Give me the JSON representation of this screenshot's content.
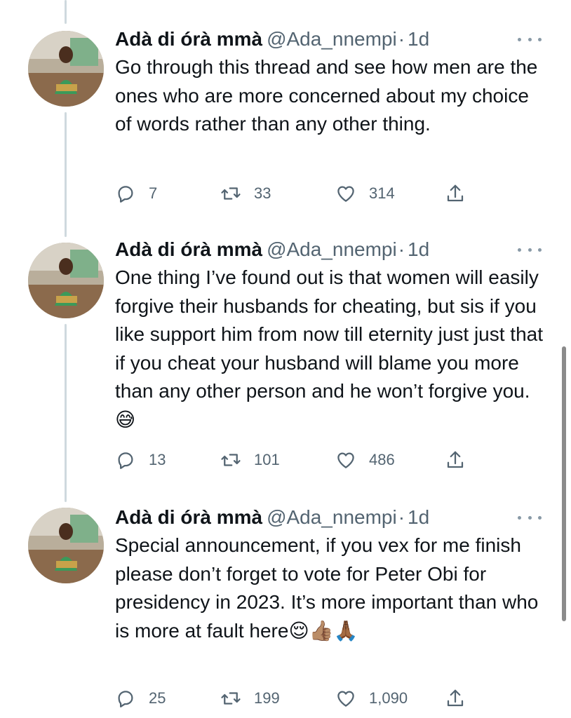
{
  "tweets": [
    {
      "name": "Adà di órà mmà",
      "handle": "@Ada_nnempi",
      "separator": "·",
      "time": "1d",
      "text": "Go through this thread and see how men are the ones who are more concerned about my choice of words rather than any other thing.",
      "emoji": "",
      "replies": "7",
      "retweets": "33",
      "likes": "314"
    },
    {
      "name": "Adà di órà mmà",
      "handle": "@Ada_nnempi",
      "separator": "·",
      "time": "1d",
      "text": "One thing I’ve found out is that women will easily forgive their husbands for cheating, but sis if you like support him from now till eternity just just that if you cheat your husband will blame you more than any other person and he won’t forgive you.",
      "emoji": "😅",
      "replies": "13",
      "retweets": "101",
      "likes": "486"
    },
    {
      "name": "Adà di órà mmà",
      "handle": "@Ada_nnempi",
      "separator": "·",
      "time": "1d",
      "text": "Special announcement, if you vex for me finish please don’t forget to vote for Peter Obi for presidency in 2023. It’s more important than who is more at fault here",
      "emoji": "😌👍🏽🙏🏾",
      "replies": "25",
      "retweets": "199",
      "likes": "1,090"
    }
  ],
  "icons": {
    "reply": "reply-icon",
    "retweet": "retweet-icon",
    "like": "heart-icon",
    "share": "share-icon",
    "more": "more-icon"
  },
  "colors": {
    "text": "#0f1419",
    "secondary": "#536471",
    "thread_line": "#cfd9de"
  }
}
